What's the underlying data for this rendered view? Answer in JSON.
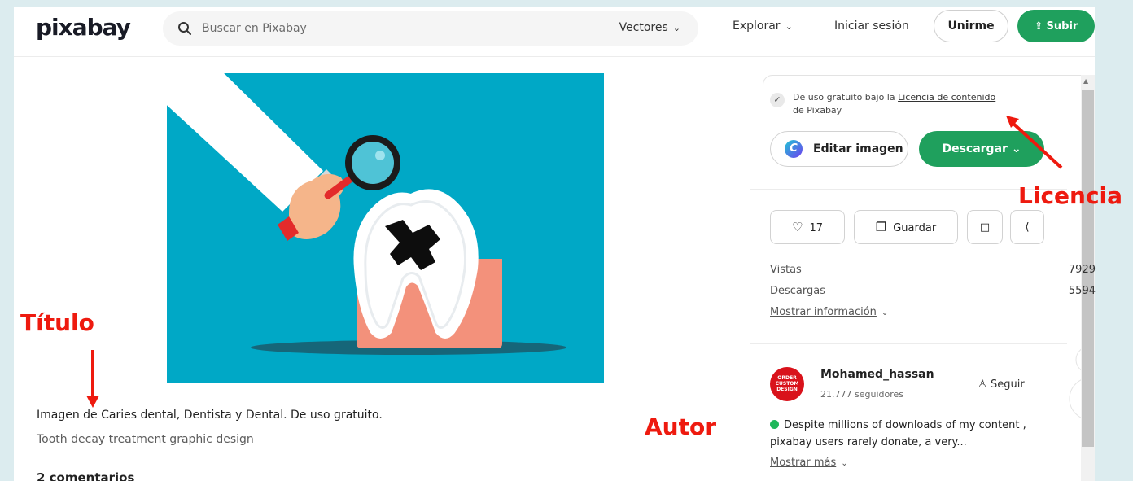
{
  "header": {
    "logo": "pixabay",
    "search_placeholder": "Buscar en Pixabay",
    "search_type": "Vectores",
    "explore": "Explorar",
    "login": "Iniciar sesión",
    "join": "Unirme",
    "upload": "Subir"
  },
  "image": {
    "title": "Imagen de Caries dental, Dentista y Dental. De uso gratuito.",
    "description": "Tooth decay treatment graphic design",
    "comments": "2 comentarios"
  },
  "sidebar": {
    "license_prefix": "De uso gratuito bajo la ",
    "license_link": "Licencia de contenido",
    "license_suffix": "de Pixabay",
    "edit_button": "Editar imagen",
    "download_button": "Descargar",
    "likes": "17",
    "save": "Guardar",
    "stats": [
      {
        "label": "Vistas",
        "value": "7929"
      },
      {
        "label": "Descargas",
        "value": "5594"
      }
    ],
    "more_info": "Mostrar información",
    "author": {
      "name": "Mohamed_hassan",
      "followers": "21.777 seguidores",
      "follow": "Seguir",
      "bio": "Despite millions of downloads of my content , pixabay users rarely donate, a very...",
      "more": "Mostrar más"
    }
  },
  "annotations": {
    "titulo": "Título",
    "autor": "Autor",
    "licencia": "Licencia"
  },
  "colors": {
    "background": "#dcecef",
    "accent_green": "#1fa05d",
    "annotation_red": "#ee1a0f",
    "illustration_bg": "#00a8c6"
  }
}
